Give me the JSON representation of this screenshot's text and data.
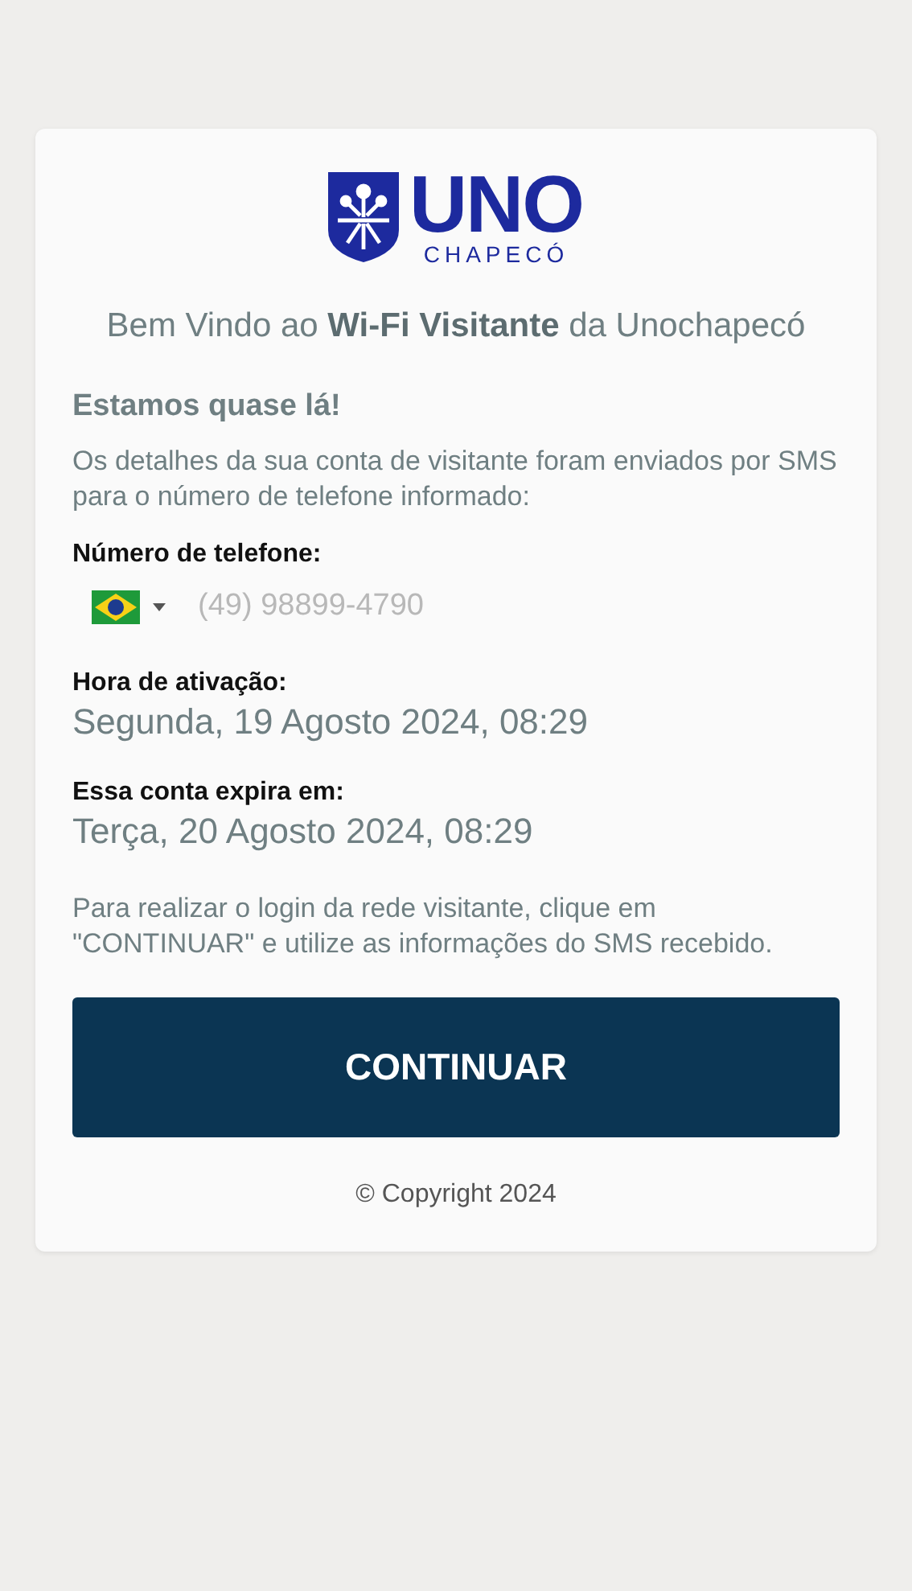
{
  "logo": {
    "wordmark": "UNO",
    "subtitle": "CHAPECÓ"
  },
  "welcome": "Bem Vindo ao **Wi-Fi Visitante** da Unochapecó",
  "heading": "Estamos quase lá!",
  "intro": "Os detalhes da sua conta de visitante foram enviados por SMS para o número de telefone informado:",
  "phone": {
    "label": "Número de telefone:",
    "value": "(49) 98899-4790",
    "disabled": true
  },
  "fields": [
    {
      "label": "Hora de ativação:",
      "value": "Segunda, 19 Agosto 2024, 08:29"
    },
    {
      "label": "Essa conta expira em:",
      "value": "Terça, 20 Agosto 2024, 08:29"
    }
  ],
  "instructions": "Para realizar o login da rede visitante, clique em \"CONTINUAR\" e utilize as informações do SMS recebido.",
  "button": "CONTINUAR",
  "copyright": "© Copyright 2024"
}
